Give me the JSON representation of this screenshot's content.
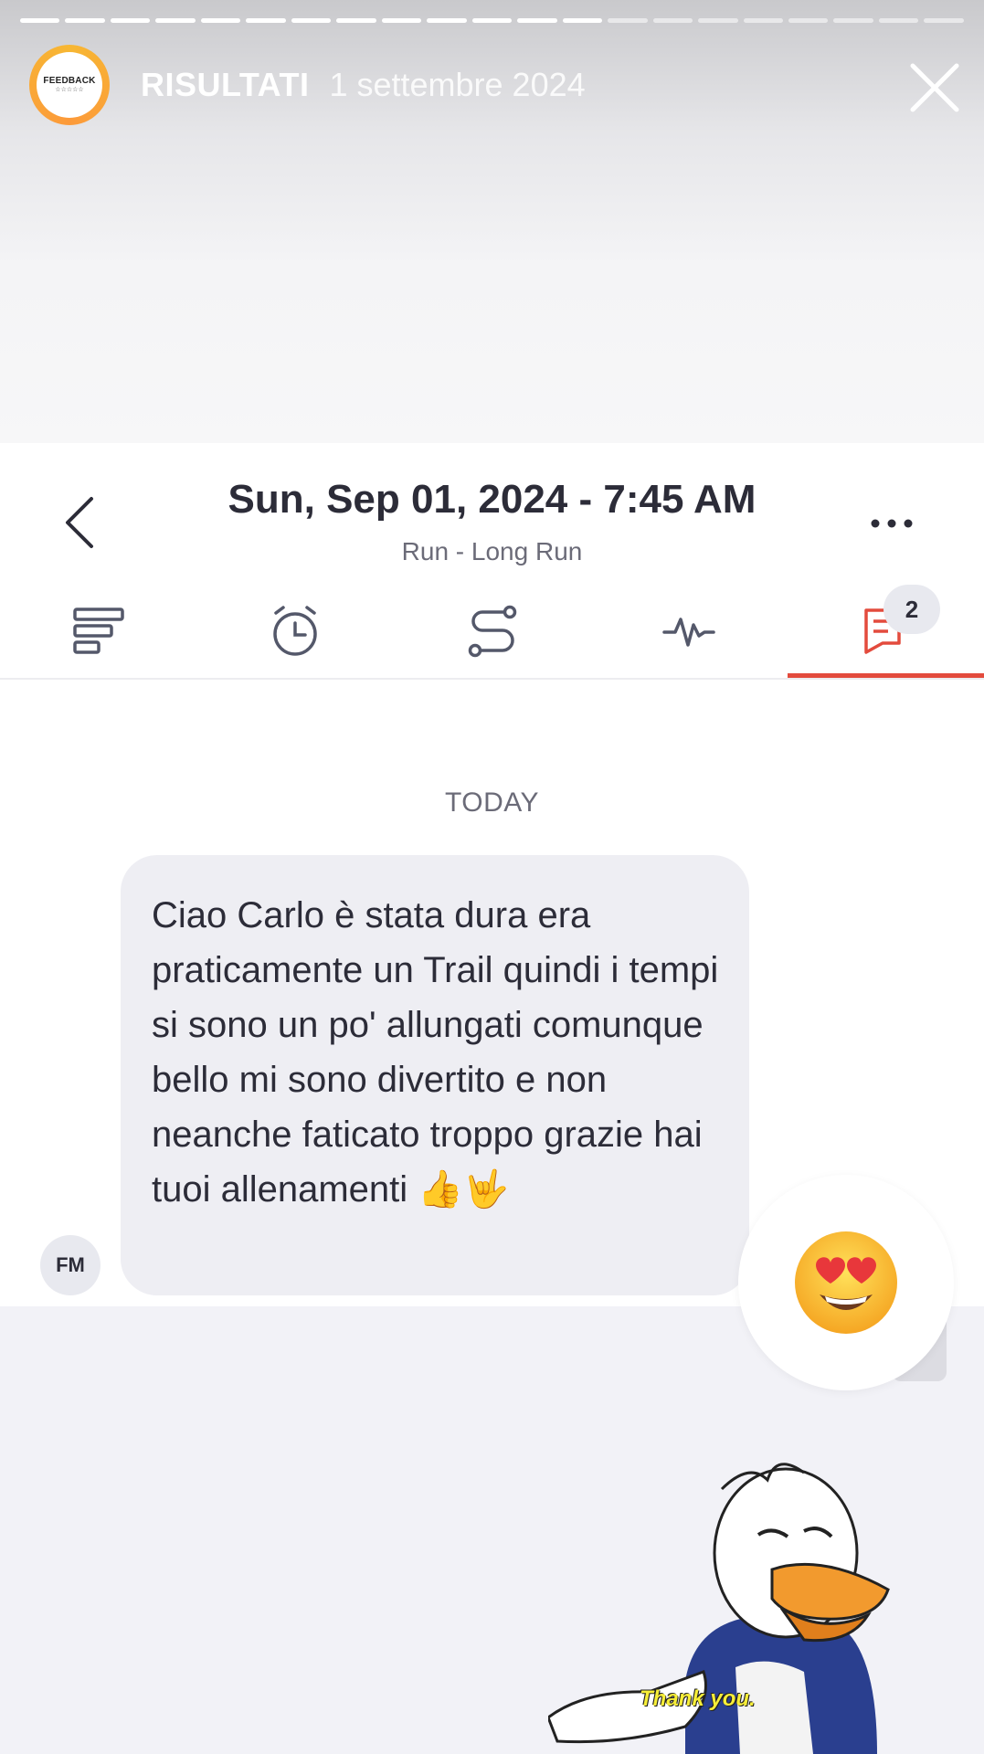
{
  "story": {
    "title": "RISULTATI",
    "date": "1 settembre 2024",
    "avatar_label": "FEEDBACK",
    "avatar_stars": "☆☆☆☆☆",
    "progress": 0.62
  },
  "header": {
    "title": "Sun, Sep 01, 2024 - 7:45 AM",
    "subtitle": "Run - Long Run"
  },
  "tabs": {
    "icons": [
      "summary-icon",
      "timer-icon",
      "route-icon",
      "activity-icon",
      "comments-icon"
    ],
    "active": 4,
    "comments_badge": "2"
  },
  "chat": {
    "day_label": "TODAY",
    "message": "Ciao Carlo è stata dura era praticamente un Trail quindi i tempi si sono un po' allungati comunque bello mi sono divertito e non neanche faticato troppo grazie hai tuoi allenamenti 👍🤟",
    "sender_initials": "FM",
    "reaction": "😍"
  },
  "sticker": {
    "caption": "Thank you."
  },
  "colors": {
    "accent": "#e34b3d",
    "text": "#2c2c38",
    "bubble": "#eeeef3"
  }
}
